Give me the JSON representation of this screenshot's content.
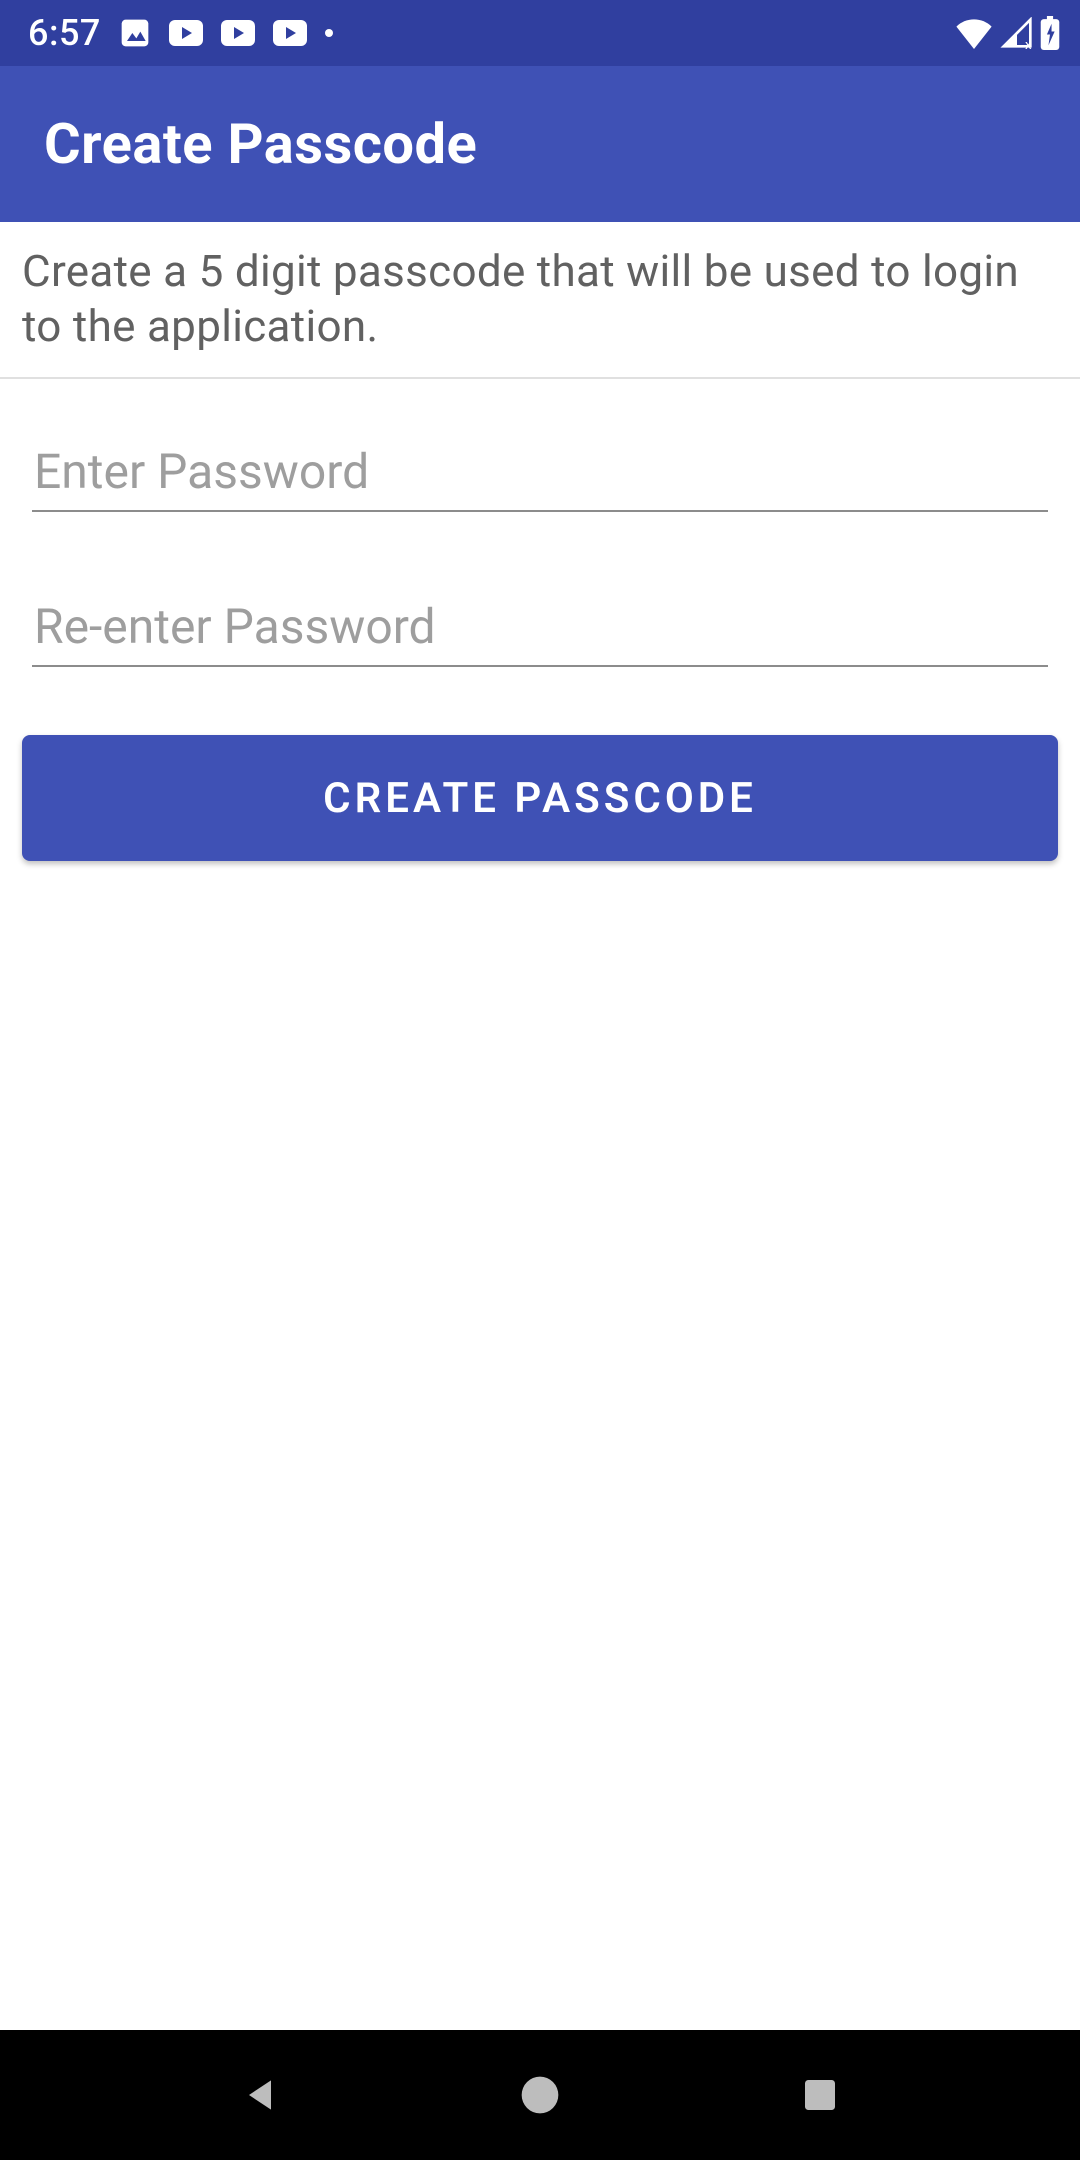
{
  "status_bar": {
    "time": "6:57",
    "icons": {
      "image": "image-icon",
      "play1": "play-icon",
      "play2": "play-icon",
      "play3": "play-icon",
      "dot": "overflow-dot",
      "wifi": "wifi-icon",
      "signal": "signal-icon",
      "battery": "battery-charging-icon"
    }
  },
  "app_bar": {
    "title": "Create Passcode"
  },
  "instruction": "Create a 5 digit passcode that will be used to login to the application.",
  "form": {
    "password_placeholder": "Enter Password",
    "password_value": "",
    "confirm_placeholder": "Re-enter Password",
    "confirm_value": "",
    "submit_label": "CREATE PASSCODE"
  },
  "nav": {
    "back": "back-icon",
    "home": "home-icon",
    "recents": "recents-icon"
  },
  "colors": {
    "primary": "#3f51b5",
    "primary_dark": "#303f9f",
    "text_muted": "#616161",
    "placeholder": "#9e9e9e",
    "underline": "#8c8c8c"
  }
}
